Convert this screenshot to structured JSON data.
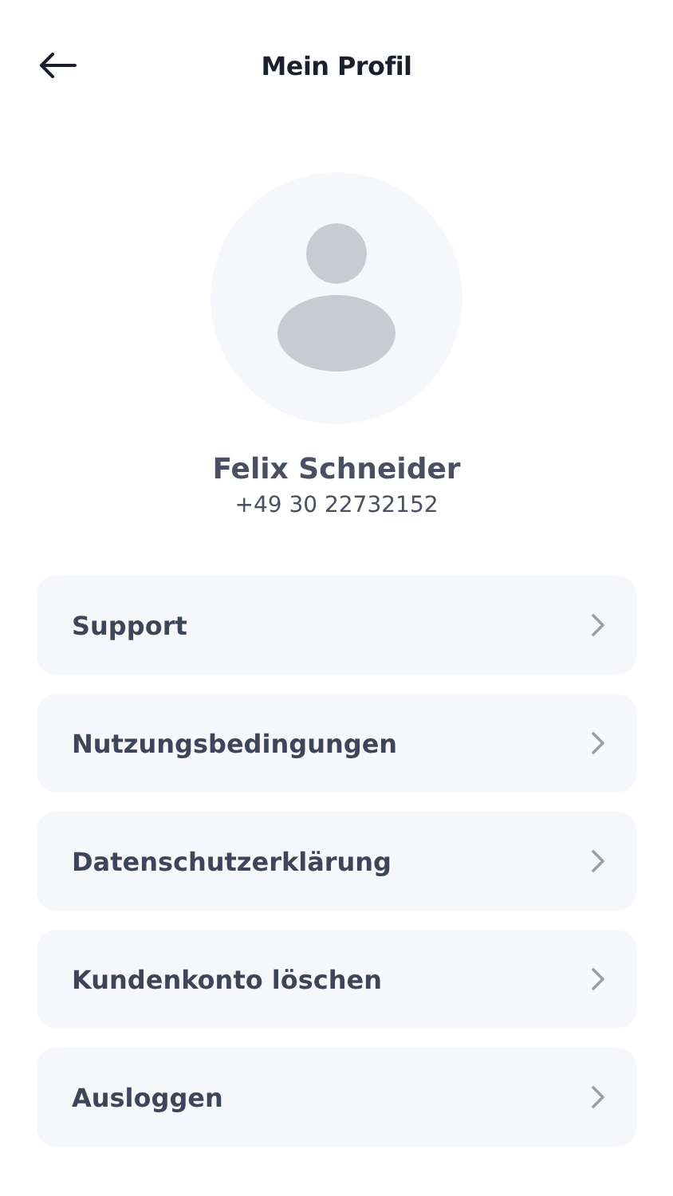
{
  "header": {
    "title": "Mein Profil"
  },
  "profile": {
    "name": "Felix Schneider",
    "phone": "+49 30 22732152"
  },
  "menu": [
    {
      "label": "Support"
    },
    {
      "label": "Nutzungsbedingungen"
    },
    {
      "label": "Datenschutzerklärung"
    },
    {
      "label": "Kundenkonto löschen"
    },
    {
      "label": "Ausloggen"
    }
  ]
}
